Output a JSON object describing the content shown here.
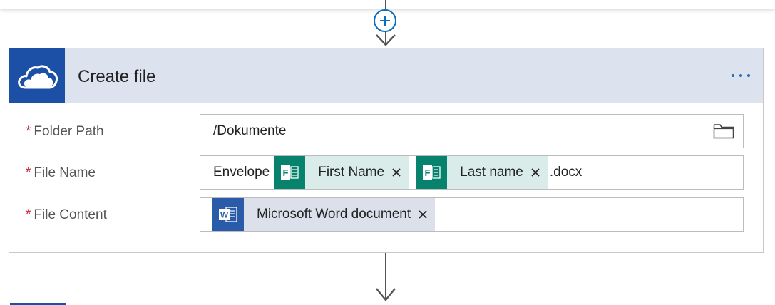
{
  "step": {
    "title": "Create file",
    "connector_icon": "onedrive-cloud-icon",
    "more_icon": "ellipsis-icon"
  },
  "add_step_icon": "plus-icon",
  "fields": {
    "folder_path": {
      "label": "Folder Path",
      "required_mark": "*",
      "value": "/Dokumente",
      "icon": "folder-icon"
    },
    "file_name": {
      "label": "File Name",
      "required_mark": "*",
      "prefix": "Envelope",
      "tokens": [
        {
          "label": "First Name",
          "icon": "microsoft-forms-icon"
        },
        {
          "label": "Last name",
          "icon": "microsoft-forms-icon"
        }
      ],
      "suffix": ".docx"
    },
    "file_content": {
      "label": "File Content",
      "required_mark": "*",
      "tokens": [
        {
          "label": "Microsoft Word document",
          "icon": "microsoft-word-icon"
        }
      ]
    }
  },
  "colors": {
    "header_background": "#dde3ee",
    "onedrive_blue": "#1c4fa6",
    "forms_green": "#07826c",
    "word_blue": "#2a5ba9",
    "accent_blue": "#0b6cc0",
    "required_red": "#c4262e"
  }
}
